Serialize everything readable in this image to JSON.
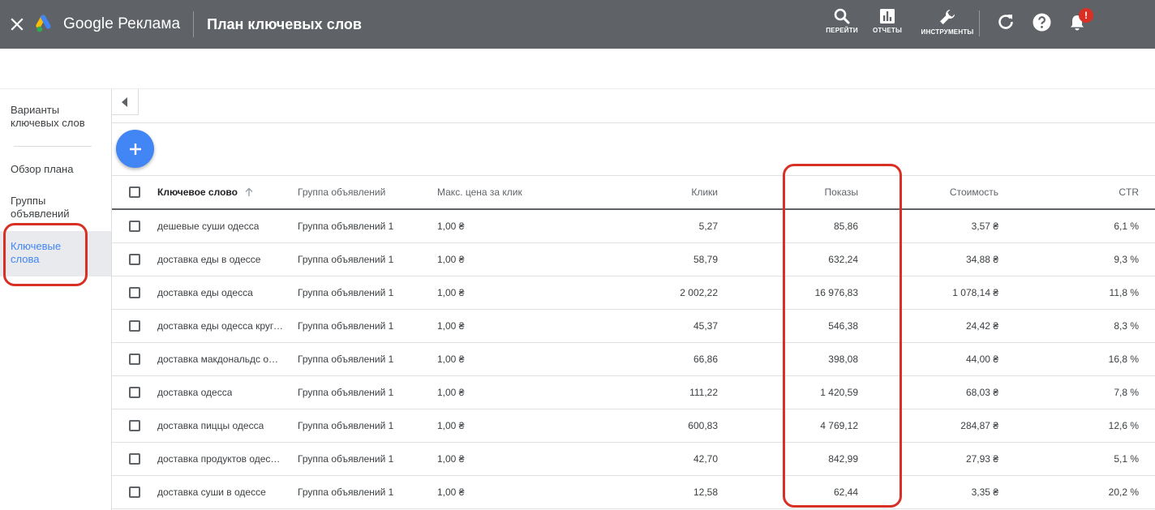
{
  "header": {
    "brand": "Google Реклама",
    "page_title": "План ключевых слов",
    "tools": [
      {
        "label": "ПЕРЕЙТИ",
        "icon": "search-icon"
      },
      {
        "label": "ОТЧЕТЫ",
        "icon": "reports-icon"
      },
      {
        "label": "ИНСТРУМЕНТЫ",
        "icon": "wrench-icon"
      }
    ],
    "notification_badge": "!"
  },
  "sidebar": {
    "items": [
      {
        "label": "Варианты ключевых слов",
        "active": false
      },
      {
        "label": "Обзор плана",
        "active": false
      },
      {
        "label": "Группы объявлений",
        "active": false
      },
      {
        "label": "Ключевые слова",
        "active": true
      }
    ]
  },
  "table": {
    "columns": {
      "keyword": "Ключевое слово",
      "ad_group": "Группа объявлений",
      "max_cpc": "Макс. цена за клик",
      "clicks": "Клики",
      "impressions": "Показы",
      "cost": "Стоимость",
      "ctr": "CTR"
    },
    "rows": [
      {
        "keyword": "дешевые суши одесса",
        "ad_group": "Группа объявлений 1",
        "max_cpc": "1,00 ₴",
        "clicks": "5,27",
        "impressions": "85,86",
        "cost": "3,57 ₴",
        "ctr": "6,1 %"
      },
      {
        "keyword": "доставка еды в одессе",
        "ad_group": "Группа объявлений 1",
        "max_cpc": "1,00 ₴",
        "clicks": "58,79",
        "impressions": "632,24",
        "cost": "34,88 ₴",
        "ctr": "9,3 %"
      },
      {
        "keyword": "доставка еды одесса",
        "ad_group": "Группа объявлений 1",
        "max_cpc": "1,00 ₴",
        "clicks": "2 002,22",
        "impressions": "16 976,83",
        "cost": "1 078,14 ₴",
        "ctr": "11,8 %"
      },
      {
        "keyword": "доставка еды одесса кругл…",
        "ad_group": "Группа объявлений 1",
        "max_cpc": "1,00 ₴",
        "clicks": "45,37",
        "impressions": "546,38",
        "cost": "24,42 ₴",
        "ctr": "8,3 %"
      },
      {
        "keyword": "доставка макдональдс о…",
        "ad_group": "Группа объявлений 1",
        "max_cpc": "1,00 ₴",
        "clicks": "66,86",
        "impressions": "398,08",
        "cost": "44,00 ₴",
        "ctr": "16,8 %"
      },
      {
        "keyword": "доставка одесса",
        "ad_group": "Группа объявлений 1",
        "max_cpc": "1,00 ₴",
        "clicks": "111,22",
        "impressions": "1 420,59",
        "cost": "68,03 ₴",
        "ctr": "7,8 %"
      },
      {
        "keyword": "доставка пиццы одесса",
        "ad_group": "Группа объявлений 1",
        "max_cpc": "1,00 ₴",
        "clicks": "600,83",
        "impressions": "4 769,12",
        "cost": "284,87 ₴",
        "ctr": "12,6 %"
      },
      {
        "keyword": "доставка продуктов одес…",
        "ad_group": "Группа объявлений 1",
        "max_cpc": "1,00 ₴",
        "clicks": "42,70",
        "impressions": "842,99",
        "cost": "27,93 ₴",
        "ctr": "5,1 %"
      },
      {
        "keyword": "доставка суши в одессе",
        "ad_group": "Группа объявлений 1",
        "max_cpc": "1,00 ₴",
        "clicks": "12,58",
        "impressions": "62,44",
        "cost": "3,35 ₴",
        "ctr": "20,2 %"
      }
    ]
  },
  "colors": {
    "topbar": "#5f6368",
    "accent": "#4285f4",
    "highlight": "#d93025"
  }
}
